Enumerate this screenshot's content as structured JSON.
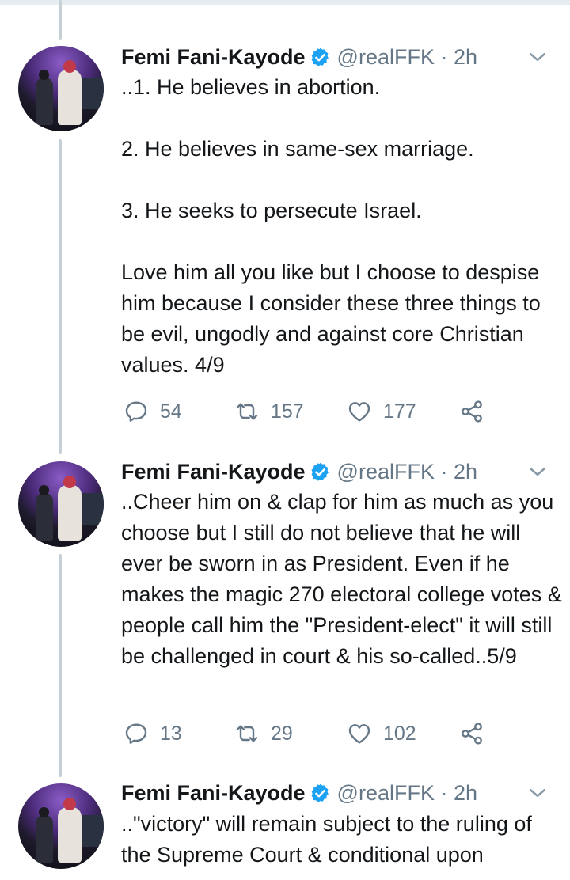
{
  "tweets": [
    {
      "author": "Femi Fani-Kayode",
      "handle": "@realFFK",
      "time": "2h",
      "text": "..1. He believes in abortion.\n\n2. He believes in same-sex marriage.\n\n3. He seeks to persecute Israel.\n\nLove him all you like but I choose to despise him because I consider these three things to be evil, ungodly and against core Christian values. 4/9",
      "replies": "54",
      "retweets": "157",
      "likes": "177"
    },
    {
      "author": "Femi Fani-Kayode",
      "handle": "@realFFK",
      "time": "2h",
      "text": "..Cheer him on & clap for him as much as you choose but I still do not believe that he will ever be sworn in as President. Even if he makes the magic 270 electoral college votes & people call him the \"President-elect\" it will still be challenged in court & his so-called..5/9",
      "replies": "13",
      "retweets": "29",
      "likes": "102"
    },
    {
      "author": "Femi Fani-Kayode",
      "handle": "@realFFK",
      "time": "2h",
      "text": "..\"victory\" will remain subject to the ruling of the Supreme Court & conditional upon"
    }
  ],
  "colors": {
    "text": "#14171a",
    "muted": "#657786",
    "verified": "#1da1f2",
    "thread_line": "#c4cfd6"
  },
  "icons": [
    "verified-badge-icon",
    "chevron-down-icon",
    "reply-icon",
    "retweet-icon",
    "like-icon",
    "share-icon"
  ]
}
